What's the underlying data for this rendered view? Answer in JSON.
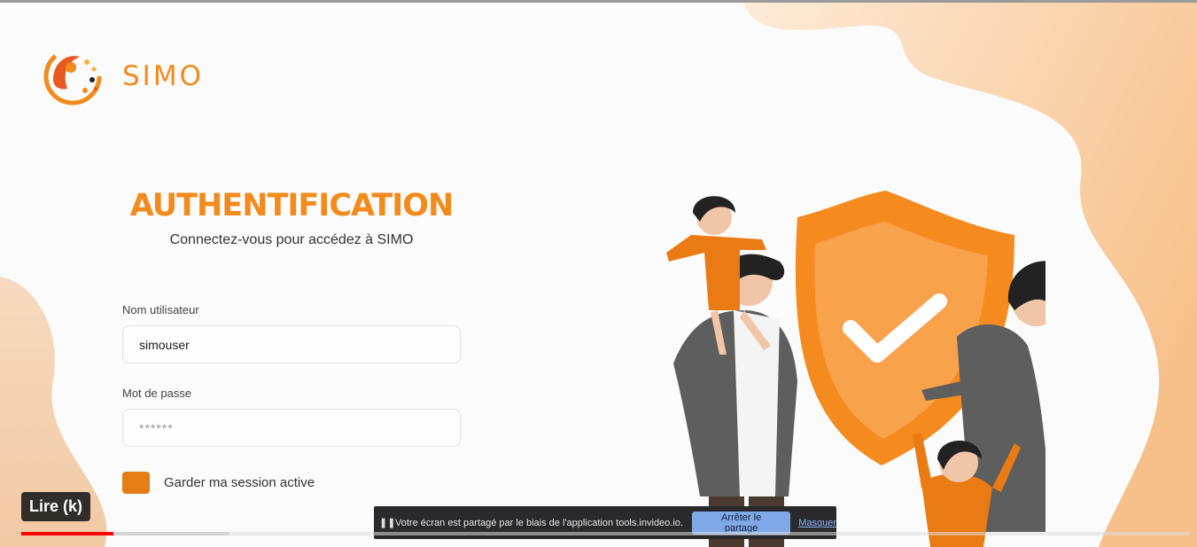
{
  "brand": {
    "name": "SIMO"
  },
  "login": {
    "title": "AUTHENTIFICATION",
    "subtitle": "Connectez-vous pour accédez à SIMO",
    "username_label": "Nom utilisateur",
    "username_value": "simouser",
    "password_label": "Mot de passe",
    "password_placeholder": "******",
    "remember_label": "Garder ma session active"
  },
  "share_banner": {
    "pause_icon": "pause-icon",
    "message": "Votre écran est partagé par le biais de l'application tools.invideo.io.",
    "stop_label": "Arrêter le partage",
    "hide_label": "Masquer"
  },
  "player": {
    "tooltip": "Lire (k)",
    "played_fraction": 0.079,
    "buffered_fraction": 0.178
  },
  "colors": {
    "accent": "#f28a1c",
    "accent_dark": "#e47d13",
    "progress": "#ff0000"
  }
}
